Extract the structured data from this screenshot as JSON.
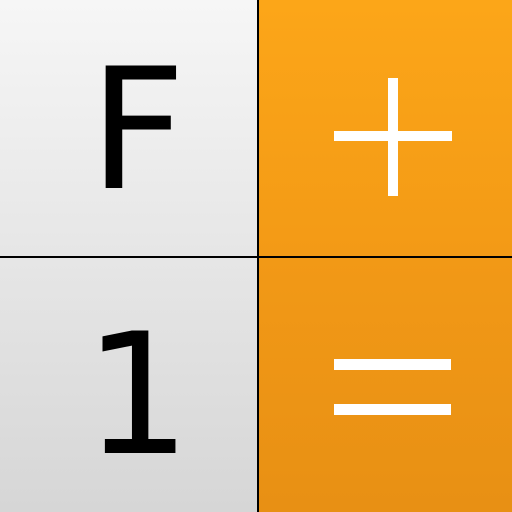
{
  "keys": {
    "f": {
      "label": "F"
    },
    "plus": {
      "label": "+"
    },
    "one": {
      "label": "1"
    },
    "equals": {
      "label": "="
    }
  },
  "colors": {
    "light_key": "#eeeeee",
    "accent_orange": "#f7a017",
    "divider": "#000000",
    "glyph_dark": "#000000",
    "glyph_light": "#ffffff"
  }
}
